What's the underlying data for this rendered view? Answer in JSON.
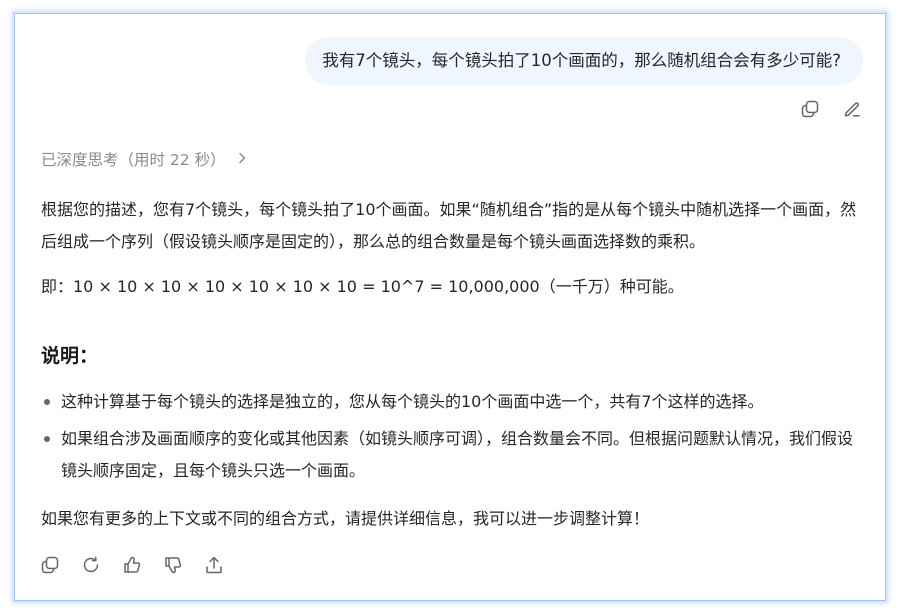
{
  "user_message": {
    "text": "我有7个镜头，每个镜头拍了10个画面的，那么随机组合会有多少可能?"
  },
  "user_actions": [
    {
      "icon": "copy-icon"
    },
    {
      "icon": "edit-icon"
    }
  ],
  "thinking": {
    "label": "已深度思考（用时 22 秒）",
    "icon": "chevron-right-icon"
  },
  "answer": {
    "intro": "根据您的描述，您有7个镜头，每个镜头拍了10个画面。如果“随机组合”指的是从每个镜头中随机选择一个画面，然后组成一个序列（假设镜头顺序是固定的），那么总的组合数量是每个镜头画面选择数的乘积。",
    "formula": "即：10 × 10 × 10 × 10 × 10 × 10 × 10 = 10^7 = 10,000,000（一千万）种可能。",
    "heading": "说明：",
    "bullets": [
      "这种计算基于每个镜头的选择是独立的，您从每个镜头的10个画面中选一个，共有7个这样的选择。",
      "如果组合涉及画面顺序的变化或其他因素（如镜头顺序可调），组合数量会不同。但根据问题默认情况，我们假设镜头顺序固定，且每个镜头只选一个画面。"
    ],
    "closing": "如果您有更多的上下文或不同的组合方式，请提供详细信息，我可以进一步调整计算！"
  },
  "bottom_actions": [
    {
      "icon": "copy-icon"
    },
    {
      "icon": "regenerate-icon"
    },
    {
      "icon": "thumbs-up-icon"
    },
    {
      "icon": "thumbs-down-icon"
    },
    {
      "icon": "share-icon"
    }
  ],
  "colors": {
    "bubble_bg": "#eff6ff",
    "text": "#262626",
    "muted": "#8b8b8b",
    "icon": "#666666",
    "frame_border": "#9fc3ee"
  }
}
